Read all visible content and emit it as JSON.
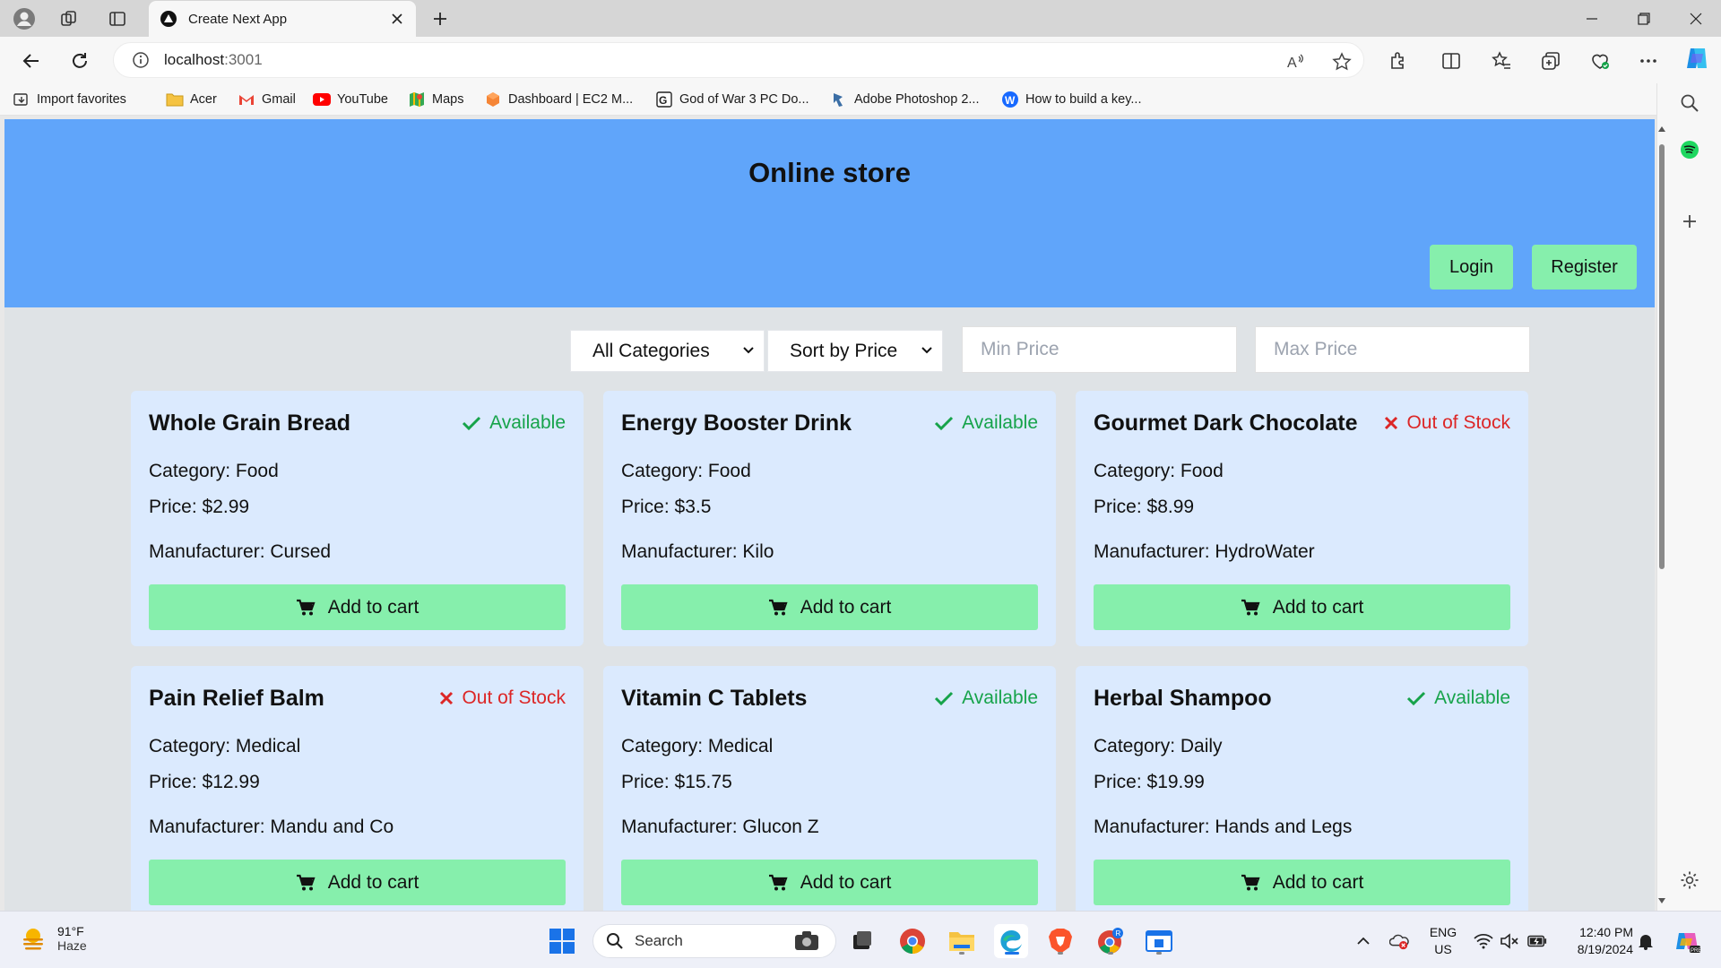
{
  "browser": {
    "tab_title": "Create Next App",
    "url_host": "localhost",
    "url_port": ":3001",
    "favorites": [
      {
        "label": "Import favorites",
        "icon": "import-icon"
      },
      {
        "label": "Acer",
        "icon": "folder-icon"
      },
      {
        "label": "Gmail",
        "icon": "gmail-icon"
      },
      {
        "label": "YouTube",
        "icon": "youtube-icon"
      },
      {
        "label": "Maps",
        "icon": "maps-icon"
      },
      {
        "label": "Dashboard | EC2 M...",
        "icon": "aws-icon"
      },
      {
        "label": "God of War 3 PC Do...",
        "icon": "site-icon"
      },
      {
        "label": "Adobe Photoshop 2...",
        "icon": "site-icon"
      },
      {
        "label": "How to build a key...",
        "icon": "wordpress-icon"
      }
    ]
  },
  "site": {
    "title": "Online store",
    "login_label": "Login",
    "register_label": "Register",
    "category_filter": "All Categories",
    "sort_filter": "Sort by Price",
    "min_price_placeholder": "Min Price",
    "max_price_placeholder": "Max Price",
    "add_to_cart_label": "Add to cart"
  },
  "products": [
    {
      "name": "Whole Grain Bread",
      "status": "Available",
      "available": true,
      "category": "Category: Food",
      "price": "Price: $2.99",
      "manufacturer": "Manufacturer: Cursed"
    },
    {
      "name": "Energy Booster Drink",
      "status": "Available",
      "available": true,
      "category": "Category: Food",
      "price": "Price: $3.5",
      "manufacturer": "Manufacturer: Kilo"
    },
    {
      "name": "Gourmet Dark Chocolate",
      "status": "Out of Stock",
      "available": false,
      "category": "Category: Food",
      "price": "Price: $8.99",
      "manufacturer": "Manufacturer: HydroWater"
    },
    {
      "name": "Pain Relief Balm",
      "status": "Out of Stock",
      "available": false,
      "category": "Category: Medical",
      "price": "Price: $12.99",
      "manufacturer": "Manufacturer: Mandu and Co"
    },
    {
      "name": "Vitamin C Tablets",
      "status": "Available",
      "available": true,
      "category": "Category: Medical",
      "price": "Price: $15.75",
      "manufacturer": "Manufacturer: Glucon Z"
    },
    {
      "name": "Herbal Shampoo",
      "status": "Available",
      "available": true,
      "category": "Category: Daily",
      "price": "Price: $19.99",
      "manufacturer": "Manufacturer: Hands and Legs"
    }
  ],
  "taskbar": {
    "temperature": "91°F",
    "condition": "Haze",
    "search_label": "Search",
    "lang_top": "ENG",
    "lang_bottom": "US",
    "time": "12:40 PM",
    "date": "8/19/2024"
  },
  "colors": {
    "header_bg": "#60a5fa",
    "card_bg": "#dbeafe",
    "button_bg": "#86efac",
    "available": "#16a34a",
    "out_of_stock": "#dc2626"
  }
}
